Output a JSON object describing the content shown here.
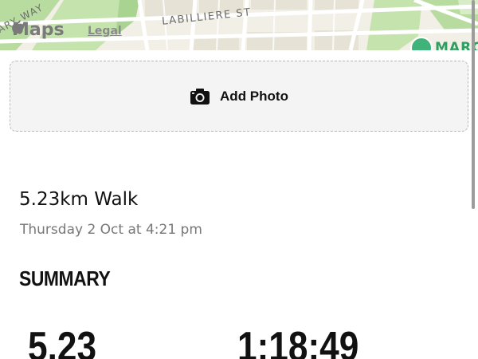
{
  "map": {
    "street_label": "LABILLIERE ST",
    "street_label_2": "ARY WAY",
    "logo_text": "Maps",
    "legal_link": "Legal",
    "poi_label": "MARC"
  },
  "add_photo": {
    "label": "Add Photo",
    "icon": "camera-icon"
  },
  "activity": {
    "title": "5.23km Walk",
    "date": "Thursday 2 Oct at 4:21 pm"
  },
  "summary": {
    "heading": "SUMMARY",
    "distance": "5.23",
    "time": "1:18:49"
  }
}
